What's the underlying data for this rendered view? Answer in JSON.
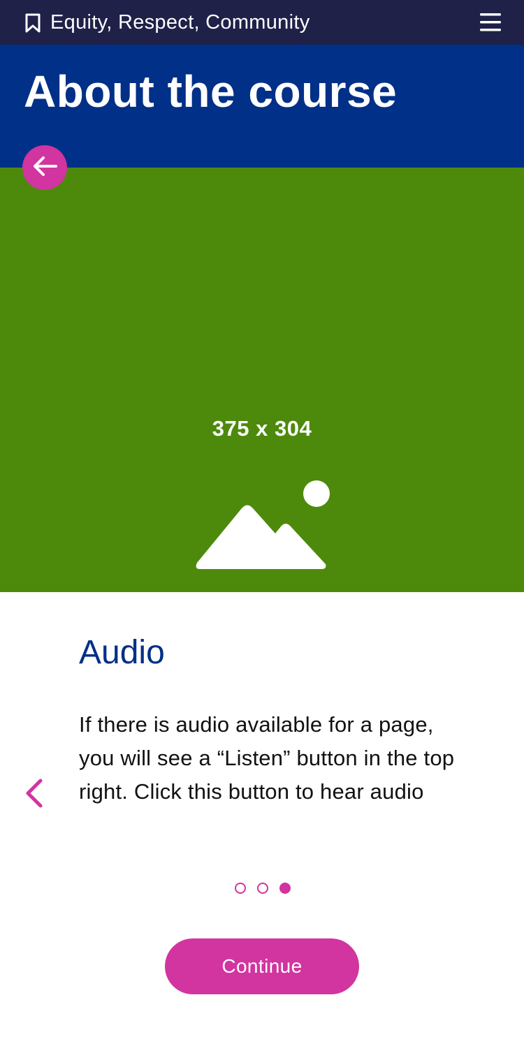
{
  "header": {
    "course_name": "Equity, Respect, Community",
    "bookmark_icon": "bookmark-icon",
    "menu_icon": "hamburger-menu-icon"
  },
  "page": {
    "title": "About the course",
    "back_icon": "arrow-left-icon"
  },
  "hero": {
    "placeholder_icon": "image-placeholder-icon",
    "dimensions_label": "375 x 304",
    "background_color": "#4d8a0b"
  },
  "card": {
    "title": "Audio",
    "body": "If there is audio available for a page, you will see a “Listen” button in the top right. Click this button to hear audio",
    "prev_icon": "chevron-left-icon"
  },
  "pagination": {
    "total": 3,
    "current": 3
  },
  "actions": {
    "continue_label": "Continue"
  },
  "colors": {
    "header_bg": "#1f2149",
    "title_bg": "#003087",
    "accent": "#d234a0",
    "heading": "#003087"
  }
}
